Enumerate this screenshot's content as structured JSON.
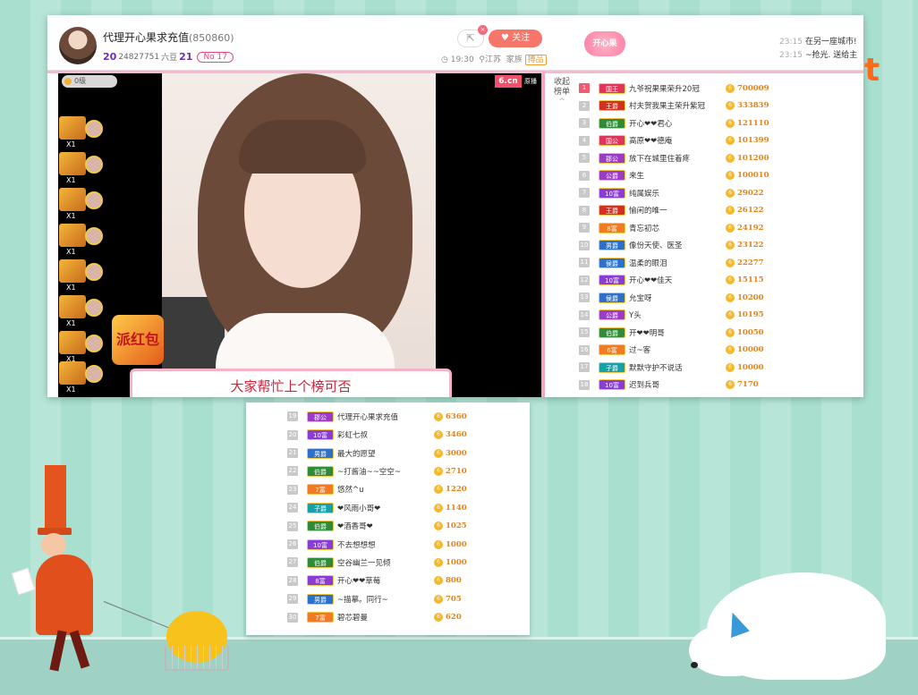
{
  "header": {
    "anchor_name": "代理开心果求充值",
    "room_id": "(850860)",
    "stat_level": "20",
    "stat_fans": "24827751",
    "stat_fans_label": "六豆",
    "stat_level2": "21",
    "no_badge": "No 17",
    "follow_label": "关注",
    "share_icon": "share-icon",
    "time": "19:30",
    "location": "江苏",
    "family_label": "家族",
    "family_tag": "搏品",
    "guard_logo": "开心果"
  },
  "notices": [
    {
      "time": "23:15",
      "text": "在另一座城市!"
    },
    {
      "time": "23:15",
      "text": "~抢光. 送给主"
    }
  ],
  "video": {
    "top_left_count": "0级",
    "site_badge": "6.cn",
    "hd_badge": "原播",
    "gifters": [
      {
        "count": "X1"
      },
      {
        "count": "X1"
      },
      {
        "count": "X1"
      },
      {
        "count": "X1"
      },
      {
        "count": "X1"
      },
      {
        "count": "X1"
      },
      {
        "count": "X1"
      },
      {
        "count": "X1"
      }
    ],
    "lucky_label": "派红包",
    "banner": "大家帮忙上个榜可否"
  },
  "rank": {
    "title_1": "收起",
    "title_2": "榜单",
    "rows_main": [
      {
        "n": "1",
        "lvl": "国王",
        "color": "#e0345a",
        "name": "九爷祝果果荣升20冠",
        "score": "700009"
      },
      {
        "n": "2",
        "lvl": "王爵",
        "color": "#d3311f",
        "name": "村夫贺我果主荣升紫冠",
        "score": "333839"
      },
      {
        "n": "3",
        "lvl": "伯爵",
        "color": "#2e8b38",
        "name": "开心❤❤君心",
        "score": "121110"
      },
      {
        "n": "4",
        "lvl": "国公",
        "color": "#e0345a",
        "name": "高原❤❤德庵",
        "score": "101399"
      },
      {
        "n": "5",
        "lvl": "郡公",
        "color": "#9b3bc6",
        "name": "放下在城里住着疼",
        "score": "101200"
      },
      {
        "n": "6",
        "lvl": "公爵",
        "color": "#9b3bc6",
        "name": "来生",
        "score": "100010"
      },
      {
        "n": "7",
        "lvl": "10富",
        "color": "#8a3dd6",
        "name": "纯属娱乐",
        "score": "29022"
      },
      {
        "n": "8",
        "lvl": "王爵",
        "color": "#d3311f",
        "name": "愉闲的唯一",
        "score": "26122"
      },
      {
        "n": "9",
        "lvl": "8富",
        "color": "#f27a22",
        "name": "青忘初芯",
        "score": "24192"
      },
      {
        "n": "10",
        "lvl": "男爵",
        "color": "#2d70c9",
        "name": "像份天使、医圣",
        "score": "23122"
      },
      {
        "n": "11",
        "lvl": "侯爵",
        "color": "#2d70c9",
        "name": "温柔的眼泪",
        "score": "22277"
      },
      {
        "n": "12",
        "lvl": "10富",
        "color": "#8a3dd6",
        "name": "开心❤❤佳天",
        "score": "15115"
      },
      {
        "n": "13",
        "lvl": "侯爵",
        "color": "#2d70c9",
        "name": "允宝呀",
        "score": "10200"
      },
      {
        "n": "14",
        "lvl": "公爵",
        "color": "#9b3bc6",
        "name": "Y头",
        "score": "10195"
      },
      {
        "n": "15",
        "lvl": "伯爵",
        "color": "#2e8b38",
        "name": "开❤❤明哥",
        "score": "10050"
      },
      {
        "n": "16",
        "lvl": "6富",
        "color": "#f27a22",
        "name": "过~客",
        "score": "10000"
      },
      {
        "n": "17",
        "lvl": "子爵",
        "color": "#16a0a8",
        "name": "默默守护不说话",
        "score": "10000"
      },
      {
        "n": "18",
        "lvl": "10富",
        "color": "#8a3dd6",
        "name": "迟到兵哥",
        "score": "7170"
      }
    ],
    "rows_more": [
      {
        "n": "19",
        "lvl": "郡公",
        "color": "#9b3bc6",
        "name": "代理开心果求充值",
        "score": "6360"
      },
      {
        "n": "20",
        "lvl": "10富",
        "color": "#8a3dd6",
        "name": "彩虹七叔",
        "score": "3460"
      },
      {
        "n": "21",
        "lvl": "男爵",
        "color": "#2d70c9",
        "name": "最大的愿望",
        "score": "3000"
      },
      {
        "n": "22",
        "lvl": "伯爵",
        "color": "#2e8b38",
        "name": "~打酱油~~空空~",
        "score": "2710"
      },
      {
        "n": "23",
        "lvl": "7富",
        "color": "#f27a22",
        "name": "悠然^u",
        "score": "1220"
      },
      {
        "n": "24",
        "lvl": "子爵",
        "color": "#16a0a8",
        "name": "❤风雨小哥❤",
        "score": "1140"
      },
      {
        "n": "25",
        "lvl": "伯爵",
        "color": "#2e8b38",
        "name": "❤酒香哥❤",
        "score": "1025"
      },
      {
        "n": "26",
        "lvl": "10富",
        "color": "#8a3dd6",
        "name": "不去想想想",
        "score": "1000"
      },
      {
        "n": "27",
        "lvl": "伯爵",
        "color": "#2e8b38",
        "name": "空谷幽兰一见倾",
        "score": "1000"
      },
      {
        "n": "28",
        "lvl": "8富",
        "color": "#8a3dd6",
        "name": "开心❤❤草莓",
        "score": "800"
      },
      {
        "n": "29",
        "lvl": "男爵",
        "color": "#2d70c9",
        "name": "~描摹。同行~",
        "score": "705"
      },
      {
        "n": "30",
        "lvl": "7富",
        "color": "#f27a22",
        "name": "碧芯碧曼",
        "score": "620"
      }
    ]
  },
  "decoration": {
    "letter": "t"
  },
  "colors": {
    "accent": "#f7766a",
    "rank_score": "#e6841b",
    "pink": "#f5a4c0"
  }
}
